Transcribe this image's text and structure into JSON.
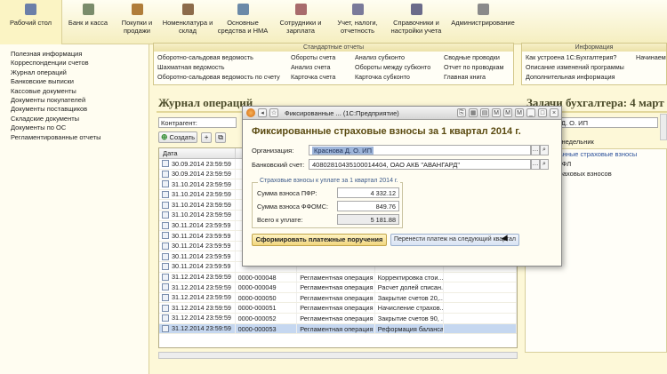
{
  "sections": [
    {
      "label": "Рабочий стол",
      "icon": "desktop-icon",
      "color": "#6b7fa8"
    },
    {
      "label": "Банк и касса",
      "icon": "bank-icon",
      "color": "#7a8c6b"
    },
    {
      "label": "Покупки и продажи",
      "icon": "cart-icon",
      "color": "#b07d3a"
    },
    {
      "label": "Номенклатура и склад",
      "icon": "warehouse-icon",
      "color": "#8c6b4a"
    },
    {
      "label": "Основные средства и НМА",
      "icon": "assets-icon",
      "color": "#6b8aa8"
    },
    {
      "label": "Сотрудники и зарплата",
      "icon": "employees-icon",
      "color": "#a86b6b"
    },
    {
      "label": "Учет, налоги, отчетность",
      "icon": "accounting-icon",
      "color": "#7a7a9a"
    },
    {
      "label": "Справочники и настройки учета",
      "icon": "book-icon",
      "color": "#6b6b8a"
    },
    {
      "label": "Администрирование",
      "icon": "admin-icon",
      "color": "#8a8a8a"
    }
  ],
  "sidebar": [
    "Полезная информация",
    "Корреспонденции счетов",
    "Журнал операций",
    "Банковские выписки",
    "Кассовые документы",
    "Документы покупателей",
    "Документы поставщиков",
    "Складские документы",
    "Документы по ОС",
    "Регламентированные отчеты"
  ],
  "standard_reports": {
    "header": "Стандартные отчеты",
    "rows": [
      [
        "Оборотно-сальдовая ведомость",
        "Обороты счета",
        "Анализ субконто",
        "Сводные проводки"
      ],
      [
        "Шахматная ведомость",
        "Анализ счета",
        "Обороты между субконто",
        "Отчет по проводкам"
      ],
      [
        "Оборотно-сальдовая ведомость по счету",
        "Карточка счета",
        "Карточка субконто",
        "Главная книга"
      ]
    ]
  },
  "info_panel": {
    "header": "Информация",
    "rows": [
      "Как устроена 1С:Бухгалтерия?",
      "Описание изменений программы",
      "Дополнительная информация"
    ],
    "extra": "Начинаем"
  },
  "journal": {
    "title": "Журнал операций",
    "counterparty_label": "Контрагент:",
    "create_label": "Создать",
    "col_date": "Дата",
    "rows": [
      {
        "date": "30.09.2014 23:59:59",
        "num": "",
        "op": "",
        "content": ""
      },
      {
        "date": "30.09.2014 23:59:59",
        "num": "",
        "op": "",
        "content": ""
      },
      {
        "date": "31.10.2014 23:59:59",
        "num": "",
        "op": "",
        "content": ""
      },
      {
        "date": "31.10.2014 23:59:59",
        "num": "",
        "op": "",
        "content": ""
      },
      {
        "date": "31.10.2014 23:59:59",
        "num": "",
        "op": "",
        "content": ""
      },
      {
        "date": "31.10.2014 23:59:59",
        "num": "",
        "op": "",
        "content": ""
      },
      {
        "date": "30.11.2014 23:59:59",
        "num": "",
        "op": "",
        "content": ""
      },
      {
        "date": "30.11.2014 23:59:59",
        "num": "",
        "op": "",
        "content": ""
      },
      {
        "date": "30.11.2014 23:59:59",
        "num": "",
        "op": "",
        "content": ""
      },
      {
        "date": "30.11.2014 23:59:59",
        "num": "",
        "op": "",
        "content": ""
      },
      {
        "date": "30.11.2014 23:59:59",
        "num": "",
        "op": "",
        "content": ""
      },
      {
        "date": "31.12.2014 23:59:59",
        "num": "0000-000048",
        "op": "Регламентная операция",
        "content": "Корректировка стои..."
      },
      {
        "date": "31.12.2014 23:59:59",
        "num": "0000-000049",
        "op": "Регламентная операция",
        "content": "Расчет долей списан..."
      },
      {
        "date": "31.12.2014 23:59:59",
        "num": "0000-000050",
        "op": "Регламентная операция",
        "content": "Закрытие счетов 20,..."
      },
      {
        "date": "31.12.2014 23:59:59",
        "num": "0000-000051",
        "op": "Регламентная операция",
        "content": "Начисление страхов..."
      },
      {
        "date": "31.12.2014 23:59:59",
        "num": "0000-000052",
        "op": "Регламентная операция",
        "content": "Закрытие счетов 90, ..."
      },
      {
        "date": "31.12.2014 23:59:59",
        "num": "0000-000053",
        "op": "Регламентная операция",
        "content": "Реформация баланса",
        "selected": true
      }
    ]
  },
  "tasks": {
    "title": "Задачи бухгалтера: 4 март",
    "org_value": "Краснова Д. О. ИП",
    "day_label": "сегодня, понедельник",
    "items": [
      {
        "text": "Фиксированные страховые взносы",
        "blue": true
      },
      {
        "text": "Уплата НДФЛ",
        "blue": false
      },
      {
        "text": "Уплата страховых взносов",
        "blue": false
      }
    ]
  },
  "dialog": {
    "window_title": "Фиксированные ... (1С:Предприятие)",
    "heading": "Фиксированные страховые взносы за 1 квартал 2014 г.",
    "org_label": "Организация:",
    "org_value": "Краснова Д. О. ИП",
    "bank_label": "Банковский счет:",
    "bank_value": "40802810435100014404, ОАО АКБ \"АВАНГАРД\"",
    "group_label": "Страховые взносы к уплате за 1 квартал 2014 г.",
    "pfr_label": "Сумма взноса ПФР:",
    "pfr_value": "4 332.12",
    "ffoms_label": "Сумма взноса ФФОМС:",
    "ffoms_value": "849.76",
    "total_label": "Всего к уплате:",
    "total_value": "5 181.88",
    "btn_generate": "Сформировать платежные поручения",
    "btn_transfer": "Перенести платеж на следующий квартал"
  }
}
